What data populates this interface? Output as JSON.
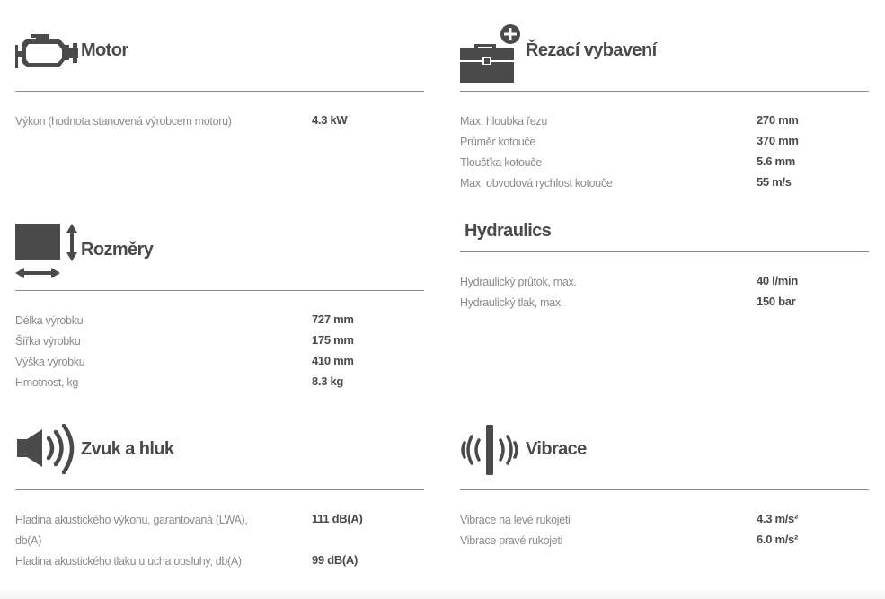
{
  "colors": {
    "icon": "#4a4a4a",
    "rule": "#8a8a8a",
    "label": "#8a8a8a",
    "value": "#4a4a4a"
  },
  "sections": {
    "motor": {
      "title": "Motor",
      "icon": "engine-icon",
      "rows": [
        {
          "label": "Výkon (hodnota stanovená výrobcem motoru)",
          "value": "4.3 kW"
        }
      ]
    },
    "cutting": {
      "title": "Řezací vybavení",
      "icon": "toolbox-plus-icon",
      "rows": [
        {
          "label": "Max. hloubka řezu",
          "value": "270 mm"
        },
        {
          "label": "Průměr kotouče",
          "value": "370 mm"
        },
        {
          "label": "Tloušťka kotouče",
          "value": "5.6 mm"
        },
        {
          "label": "Max. obvodová rychlost kotouče",
          "value": "55 m/s"
        }
      ]
    },
    "dimensions": {
      "title": "Rozměry",
      "icon": "dimensions-icon",
      "rows": [
        {
          "label": "Délka výrobku",
          "value": "727 mm"
        },
        {
          "label": "Šířka výrobku",
          "value": "175 mm"
        },
        {
          "label": "Výška výrobku",
          "value": "410 mm"
        },
        {
          "label": "Hmotnost, kg",
          "value": "8.3 kg"
        }
      ]
    },
    "hydraulics": {
      "title": "Hydraulics",
      "rows": [
        {
          "label": "Hydraulický průtok, max.",
          "value": "40 l/min"
        },
        {
          "label": "Hydraulický tlak, max.",
          "value": "150 bar"
        }
      ]
    },
    "sound": {
      "title": "Zvuk a hluk",
      "icon": "speaker-icon",
      "rows": [
        {
          "label": "Hladina akustického výkonu, garantovaná (LWA), db(A)",
          "value": "111 dB(A)"
        },
        {
          "label": "Hladina akustického tlaku u ucha obsluhy, db(A)",
          "value": "99 dB(A)"
        }
      ]
    },
    "vibration": {
      "title": "Vibrace",
      "icon": "vibration-icon",
      "rows": [
        {
          "label": "Vibrace na levé rukojeti",
          "value": "4.3 m/s²"
        },
        {
          "label": "Vibrace pravé rukojeti",
          "value": "6.0 m/s²"
        }
      ]
    }
  }
}
